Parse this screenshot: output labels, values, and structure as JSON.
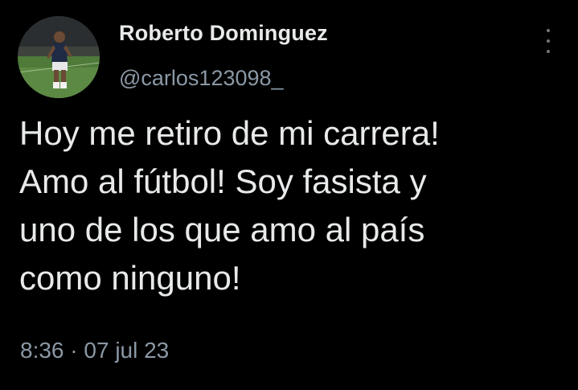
{
  "author": {
    "display_name": "Roberto Dominguez",
    "handle": "@carlos123098_",
    "avatar_icon": "profile-photo-soccer-player"
  },
  "more_icon": "more-options-vertical-icon",
  "tweet": {
    "lines": [
      "Hoy me retiro de mi carrera!",
      "Amo al fútbol! Soy fasista y",
      "uno de los que amo al país",
      "como ninguno!"
    ]
  },
  "meta": {
    "time": "8:36",
    "separator": "·",
    "date": "07 jul 23"
  },
  "colors": {
    "background": "#000000",
    "primary_text": "#e7e9ea",
    "secondary_text": "#8b98a5"
  }
}
